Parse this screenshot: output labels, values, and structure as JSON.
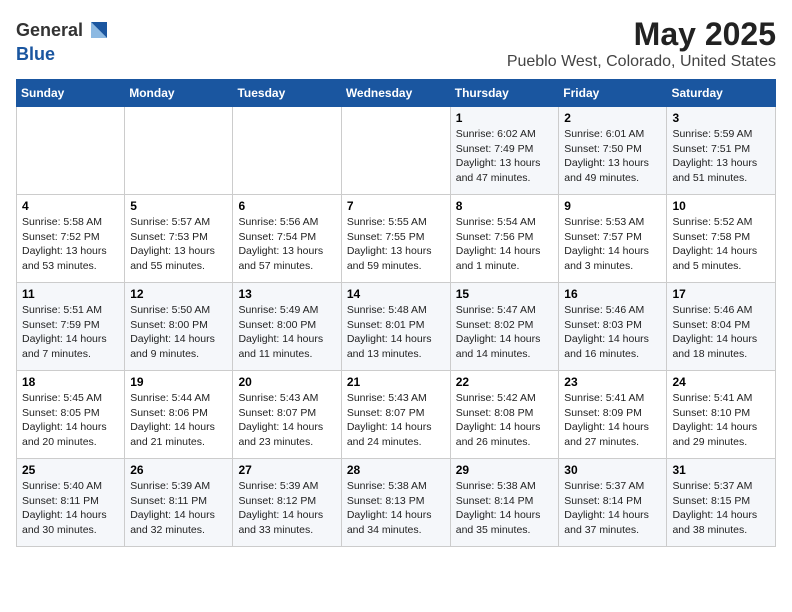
{
  "header": {
    "logo_general": "General",
    "logo_blue": "Blue",
    "title": "May 2025",
    "subtitle": "Pueblo West, Colorado, United States"
  },
  "days_of_week": [
    "Sunday",
    "Monday",
    "Tuesday",
    "Wednesday",
    "Thursday",
    "Friday",
    "Saturday"
  ],
  "weeks": [
    [
      {
        "day": "",
        "info": ""
      },
      {
        "day": "",
        "info": ""
      },
      {
        "day": "",
        "info": ""
      },
      {
        "day": "",
        "info": ""
      },
      {
        "day": "1",
        "info": "Sunrise: 6:02 AM\nSunset: 7:49 PM\nDaylight: 13 hours\nand 47 minutes."
      },
      {
        "day": "2",
        "info": "Sunrise: 6:01 AM\nSunset: 7:50 PM\nDaylight: 13 hours\nand 49 minutes."
      },
      {
        "day": "3",
        "info": "Sunrise: 5:59 AM\nSunset: 7:51 PM\nDaylight: 13 hours\nand 51 minutes."
      }
    ],
    [
      {
        "day": "4",
        "info": "Sunrise: 5:58 AM\nSunset: 7:52 PM\nDaylight: 13 hours\nand 53 minutes."
      },
      {
        "day": "5",
        "info": "Sunrise: 5:57 AM\nSunset: 7:53 PM\nDaylight: 13 hours\nand 55 minutes."
      },
      {
        "day": "6",
        "info": "Sunrise: 5:56 AM\nSunset: 7:54 PM\nDaylight: 13 hours\nand 57 minutes."
      },
      {
        "day": "7",
        "info": "Sunrise: 5:55 AM\nSunset: 7:55 PM\nDaylight: 13 hours\nand 59 minutes."
      },
      {
        "day": "8",
        "info": "Sunrise: 5:54 AM\nSunset: 7:56 PM\nDaylight: 14 hours\nand 1 minute."
      },
      {
        "day": "9",
        "info": "Sunrise: 5:53 AM\nSunset: 7:57 PM\nDaylight: 14 hours\nand 3 minutes."
      },
      {
        "day": "10",
        "info": "Sunrise: 5:52 AM\nSunset: 7:58 PM\nDaylight: 14 hours\nand 5 minutes."
      }
    ],
    [
      {
        "day": "11",
        "info": "Sunrise: 5:51 AM\nSunset: 7:59 PM\nDaylight: 14 hours\nand 7 minutes."
      },
      {
        "day": "12",
        "info": "Sunrise: 5:50 AM\nSunset: 8:00 PM\nDaylight: 14 hours\nand 9 minutes."
      },
      {
        "day": "13",
        "info": "Sunrise: 5:49 AM\nSunset: 8:00 PM\nDaylight: 14 hours\nand 11 minutes."
      },
      {
        "day": "14",
        "info": "Sunrise: 5:48 AM\nSunset: 8:01 PM\nDaylight: 14 hours\nand 13 minutes."
      },
      {
        "day": "15",
        "info": "Sunrise: 5:47 AM\nSunset: 8:02 PM\nDaylight: 14 hours\nand 14 minutes."
      },
      {
        "day": "16",
        "info": "Sunrise: 5:46 AM\nSunset: 8:03 PM\nDaylight: 14 hours\nand 16 minutes."
      },
      {
        "day": "17",
        "info": "Sunrise: 5:46 AM\nSunset: 8:04 PM\nDaylight: 14 hours\nand 18 minutes."
      }
    ],
    [
      {
        "day": "18",
        "info": "Sunrise: 5:45 AM\nSunset: 8:05 PM\nDaylight: 14 hours\nand 20 minutes."
      },
      {
        "day": "19",
        "info": "Sunrise: 5:44 AM\nSunset: 8:06 PM\nDaylight: 14 hours\nand 21 minutes."
      },
      {
        "day": "20",
        "info": "Sunrise: 5:43 AM\nSunset: 8:07 PM\nDaylight: 14 hours\nand 23 minutes."
      },
      {
        "day": "21",
        "info": "Sunrise: 5:43 AM\nSunset: 8:07 PM\nDaylight: 14 hours\nand 24 minutes."
      },
      {
        "day": "22",
        "info": "Sunrise: 5:42 AM\nSunset: 8:08 PM\nDaylight: 14 hours\nand 26 minutes."
      },
      {
        "day": "23",
        "info": "Sunrise: 5:41 AM\nSunset: 8:09 PM\nDaylight: 14 hours\nand 27 minutes."
      },
      {
        "day": "24",
        "info": "Sunrise: 5:41 AM\nSunset: 8:10 PM\nDaylight: 14 hours\nand 29 minutes."
      }
    ],
    [
      {
        "day": "25",
        "info": "Sunrise: 5:40 AM\nSunset: 8:11 PM\nDaylight: 14 hours\nand 30 minutes."
      },
      {
        "day": "26",
        "info": "Sunrise: 5:39 AM\nSunset: 8:11 PM\nDaylight: 14 hours\nand 32 minutes."
      },
      {
        "day": "27",
        "info": "Sunrise: 5:39 AM\nSunset: 8:12 PM\nDaylight: 14 hours\nand 33 minutes."
      },
      {
        "day": "28",
        "info": "Sunrise: 5:38 AM\nSunset: 8:13 PM\nDaylight: 14 hours\nand 34 minutes."
      },
      {
        "day": "29",
        "info": "Sunrise: 5:38 AM\nSunset: 8:14 PM\nDaylight: 14 hours\nand 35 minutes."
      },
      {
        "day": "30",
        "info": "Sunrise: 5:37 AM\nSunset: 8:14 PM\nDaylight: 14 hours\nand 37 minutes."
      },
      {
        "day": "31",
        "info": "Sunrise: 5:37 AM\nSunset: 8:15 PM\nDaylight: 14 hours\nand 38 minutes."
      }
    ]
  ]
}
